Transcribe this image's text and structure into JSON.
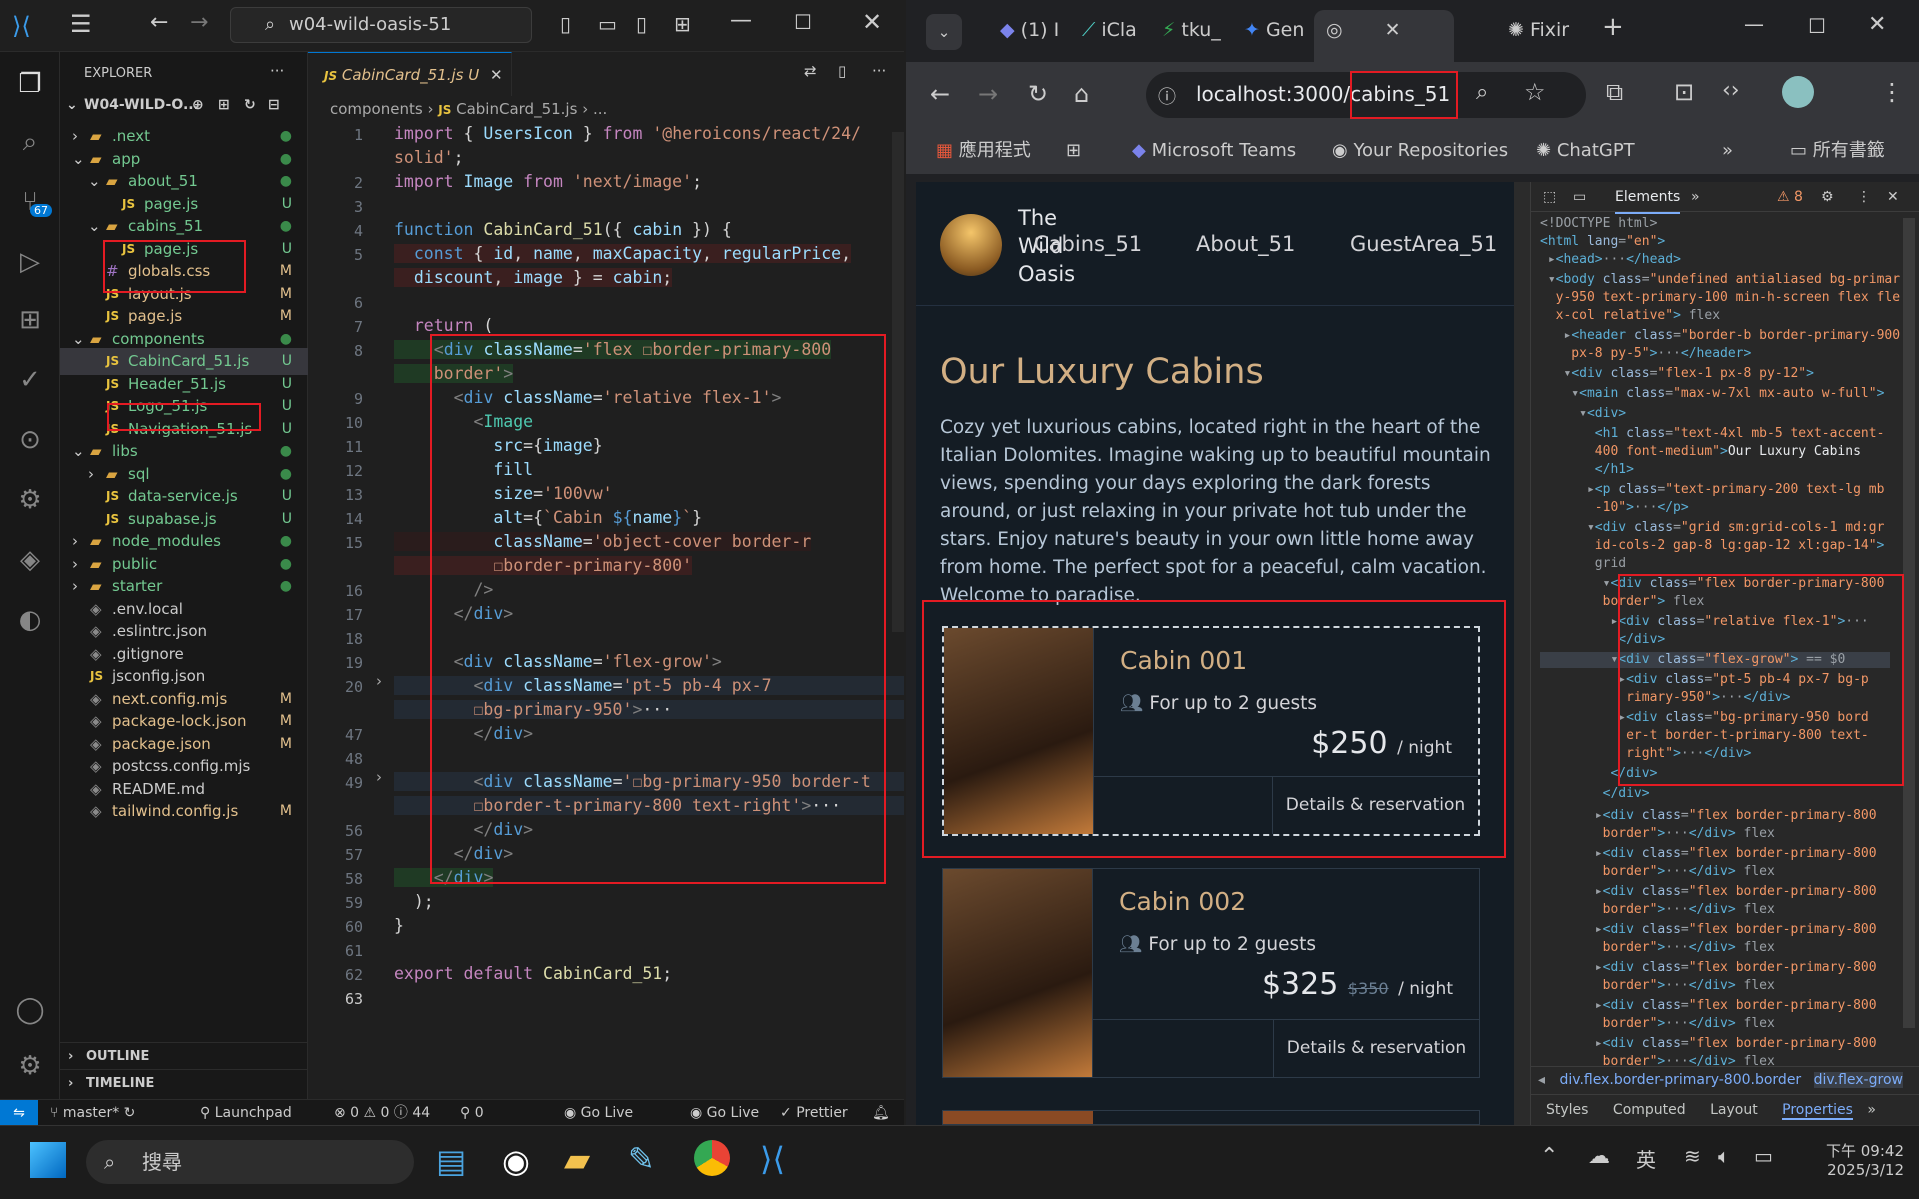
{
  "vscode": {
    "search_text": "w04-wild-oasis-51",
    "explorer_title": "EXPLORER",
    "root": "W04-WILD-O...",
    "tree": [
      {
        "name": ".next",
        "status": "●"
      },
      {
        "name": "app",
        "status": "●"
      },
      {
        "name": "about_51",
        "status": "●"
      },
      {
        "name": "page.js",
        "status": "U"
      },
      {
        "name": "cabins_51",
        "status": "●"
      },
      {
        "name": "page.js",
        "status": "U"
      },
      {
        "name": "globals.css",
        "status": "M"
      },
      {
        "name": "layout.js",
        "status": "M"
      },
      {
        "name": "page.js",
        "status": "M"
      },
      {
        "name": "components",
        "status": "●"
      },
      {
        "name": "CabinCard_51.js",
        "status": "U"
      },
      {
        "name": "Header_51.js",
        "status": "U"
      },
      {
        "name": "Logo_51.js",
        "status": "U"
      },
      {
        "name": "Navigation_51.js",
        "status": "U"
      },
      {
        "name": "libs",
        "status": "●"
      },
      {
        "name": "sql",
        "status": "●"
      },
      {
        "name": "data-service.js",
        "status": "U"
      },
      {
        "name": "supabase.js",
        "status": "U"
      },
      {
        "name": "node_modules",
        "status": "●"
      },
      {
        "name": "public",
        "status": "●"
      },
      {
        "name": "starter",
        "status": "●"
      },
      {
        "name": ".env.local",
        "status": ""
      },
      {
        "name": ".eslintrc.json",
        "status": ""
      },
      {
        "name": ".gitignore",
        "status": ""
      },
      {
        "name": "jsconfig.json",
        "status": ""
      },
      {
        "name": "next.config.mjs",
        "status": "M"
      },
      {
        "name": "package-lock.json",
        "status": "M"
      },
      {
        "name": "package.json",
        "status": "M"
      },
      {
        "name": "postcss.config.mjs",
        "status": ""
      },
      {
        "name": "README.md",
        "status": ""
      },
      {
        "name": "tailwind.config.js",
        "status": "M"
      }
    ],
    "outline": "OUTLINE",
    "timeline": "TIMELINE",
    "tab_name": "CabinCard_51.js",
    "tab_status": "U",
    "breadcrumb": [
      "components",
      "CabinCard_51.js",
      "..."
    ],
    "line_numbers": [
      "1",
      "2",
      "3",
      "4",
      "5",
      "6",
      "7",
      "8",
      "9",
      "10",
      "11",
      "12",
      "13",
      "14",
      "15",
      "16",
      "17",
      "18",
      "19",
      "20",
      "47",
      "48",
      "49",
      "56",
      "57",
      "58",
      "59",
      "60",
      "61",
      "62",
      "63"
    ],
    "status": {
      "branch": "master*",
      "launchpad": "Launchpad",
      "problems": "⊗ 0 ⚠ 0 ⓘ 44",
      "ports": "0",
      "golive1": "Go Live",
      "golive2": "Go Live",
      "prettier": "Prettier"
    }
  },
  "browser": {
    "tabs": [
      "(1) Ⅰ",
      "iCla",
      "tku_",
      "Gen",
      "",
      "Fixir"
    ],
    "url": "localhost:3000/cabins_51",
    "bookmarks": [
      "應用程式",
      "Microsoft Teams",
      "Your Repositories",
      "ChatGPT",
      "所有書籤"
    ],
    "site": {
      "logo_text": "The Wild Oasis",
      "nav": [
        "Cabins_51",
        "About_51",
        "GuestArea_51"
      ],
      "heading": "Our Luxury Cabins",
      "intro": "Cozy yet luxurious cabins, located right in the heart of the Italian Dolomites. Imagine waking up to beautiful mountain views, spending your days exploring the dark forests around, or just relaxing in your private hot tub under the stars. Enjoy nature's beauty in your own little home away from home. The perfect spot for a peaceful, calm vacation. Welcome to paradise.",
      "cabins": [
        {
          "name": "Cabin 001",
          "guests": "For up to 2 guests",
          "price": "$250",
          "old_price": "",
          "per": "/ night",
          "link": "Details & reservation"
        },
        {
          "name": "Cabin 002",
          "guests": "For up to 2 guests",
          "price": "$325",
          "old_price": "$350",
          "per": "/ night",
          "link": "Details & reservation"
        }
      ]
    },
    "devtools": {
      "tab_elements": "Elements",
      "issues": "8",
      "crumbs": [
        "div.flex.border-primary-800.border",
        "div.flex-grow"
      ],
      "bottom_tabs": [
        "Styles",
        "Computed",
        "Layout",
        "Properties"
      ]
    }
  },
  "taskbar": {
    "search": "搜尋",
    "ime": "英",
    "time": "下午 09:42",
    "date": "2025/3/12"
  },
  "colors": {
    "accent": "#e31b23",
    "site_accent": "#d2af84",
    "vs_blue": "#0078d4"
  }
}
